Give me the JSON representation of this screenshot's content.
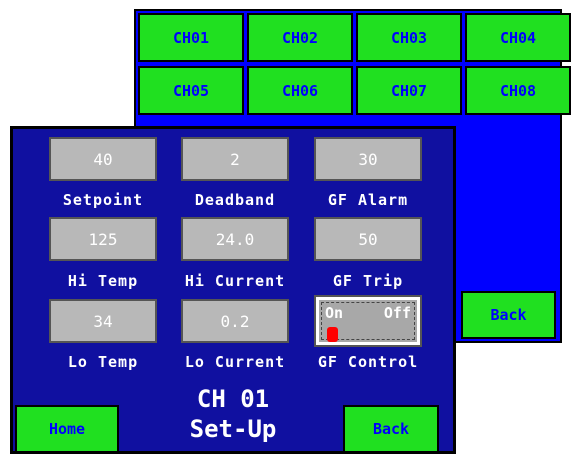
{
  "rear_panel": {
    "channels": [
      "CH01",
      "CH02",
      "CH03",
      "CH04",
      "CH05",
      "CH06",
      "CH07",
      "CH08"
    ],
    "back_label": "Back"
  },
  "front_panel": {
    "fields": [
      {
        "value": "40",
        "label": "Setpoint"
      },
      {
        "value": "2",
        "label": "Deadband"
      },
      {
        "value": "30",
        "label": "GF Alarm"
      },
      {
        "value": "125",
        "label": "Hi Temp"
      },
      {
        "value": "24.0",
        "label": "Hi Current"
      },
      {
        "value": "50",
        "label": "GF Trip"
      },
      {
        "value": "34",
        "label": "Lo Temp"
      },
      {
        "value": "0.2",
        "label": "Lo Current"
      }
    ],
    "gf_control": {
      "label": "GF Control",
      "on_label": "On",
      "off_label": "Off"
    },
    "title_line1": "CH 01",
    "title_line2": "Set-Up",
    "home_label": "Home",
    "back_label": "Back"
  },
  "colors": {
    "button_green": "#20e020",
    "rear_blue": "#0000ff",
    "front_navy": "#1010a0",
    "field_gray": "#b8b8b8",
    "toggle_knob": "#ff0000"
  }
}
